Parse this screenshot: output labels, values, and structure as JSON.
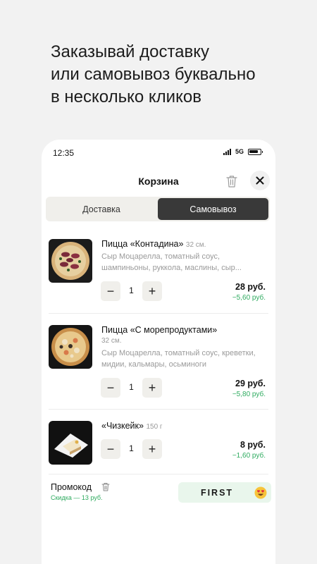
{
  "headline": {
    "line1": "Заказывай доставку",
    "line2": "или самовывоз буквально",
    "line3": "в несколько кликов"
  },
  "status_bar": {
    "time": "12:35",
    "network": "5G"
  },
  "header": {
    "title": "Корзина"
  },
  "tabs": {
    "delivery": "Доставка",
    "pickup": "Самовывоз",
    "selected": "pickup"
  },
  "cart": {
    "items": [
      {
        "name": "Пицца «Контадина»",
        "size": "32 см.",
        "description": "Сыр Моцарелла, томатный соус, шампиньоны, руккола, маслины, сыр...",
        "quantity": "1",
        "price": "28 руб.",
        "discount": "−5,60 руб."
      },
      {
        "name": "Пицца «С морепродуктами»",
        "size": "32 см.",
        "description": "Сыр Моцарелла, томатный соус, креветки, мидии, кальмары, осьминоги",
        "quantity": "1",
        "price": "29 руб.",
        "discount": "−5,80 руб."
      },
      {
        "name": "«Чизкейк»",
        "size": "150 г",
        "description": "",
        "quantity": "1",
        "price": "8 руб.",
        "discount": "−1,60 руб."
      }
    ]
  },
  "promo": {
    "label": "Промокод",
    "note": "Скидка — 13 руб.",
    "code": "FIRST",
    "emoji_icon": "heart-eyes-emoji-icon"
  },
  "colors": {
    "accent_green": "#2eab5f",
    "selected_tab": "#393939",
    "promo_bg": "#e9f6ec"
  }
}
